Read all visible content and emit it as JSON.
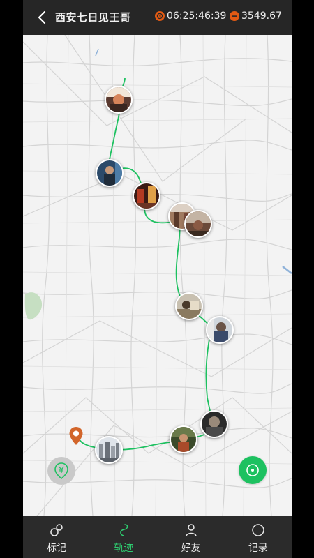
{
  "header": {
    "title": "西安七日见王哥",
    "duration": "06:25:46:39",
    "distance": "3549.67",
    "accent": "#e25a13"
  },
  "map": {
    "route_color": "#1dc160",
    "start_pin_color": "#d2652a",
    "photo_markers": [
      "photo-1",
      "photo-2",
      "photo-3",
      "photo-4",
      "photo-5",
      "photo-6",
      "photo-7",
      "photo-8",
      "photo-9",
      "photo-10"
    ]
  },
  "tabs": [
    {
      "label": "标记",
      "icon": "markers-icon",
      "active": false
    },
    {
      "label": "轨迹",
      "icon": "track-icon",
      "active": true
    },
    {
      "label": "好友",
      "icon": "friends-icon",
      "active": false
    },
    {
      "label": "记录",
      "icon": "record-icon",
      "active": false
    }
  ],
  "colors": {
    "header_bg": "#262626",
    "tabbar_bg": "#2b2b2b",
    "active_tab": "#2ecb6f",
    "fab_green": "#1dc160"
  }
}
